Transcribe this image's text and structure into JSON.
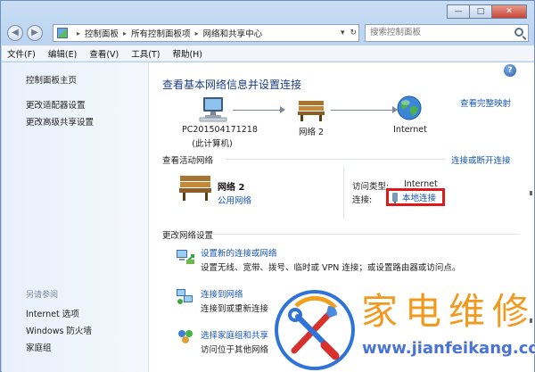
{
  "window": {
    "controls": {
      "minimize": "—",
      "maximize": "□",
      "close": "✕"
    },
    "address": {
      "breadcrumbs": [
        "控制面板",
        "所有控制面板项",
        "网络和共享中心"
      ],
      "separator": "▸",
      "dropdown": "▾",
      "refresh": "↻"
    },
    "search": {
      "placeholder": "搜索控制面板"
    },
    "nav": {
      "back": "◀",
      "forward": "▶"
    }
  },
  "menubar": {
    "items": [
      "文件(F)",
      "编辑(E)",
      "查看(V)",
      "工具(T)",
      "帮助(H)"
    ]
  },
  "sidebar": {
    "home": "控制面板主页",
    "links": [
      "更改适配器设置",
      "更改高级共享设置"
    ],
    "see_also_heading": "另请参阅",
    "see_also": [
      "Internet 选项",
      "Windows 防火墙",
      "家庭组"
    ]
  },
  "main": {
    "help": "?",
    "title": "查看基本网络信息并设置连接",
    "view_full_map": "查看完整映射",
    "map": {
      "computer_name": "PC201504171218",
      "computer_sub": "(此计算机)",
      "network_name": "网络  2",
      "internet": "Internet"
    },
    "active_heading": "查看活动网络",
    "connect_disconnect": "连接或断开连接",
    "active": {
      "name": "网络  2",
      "type": "公用网络",
      "access_type_label": "访问类型:",
      "access_type_value": "Internet",
      "connections_label": "连接:",
      "connection": "本地连接"
    },
    "change_heading": "更改网络设置",
    "tasks": [
      {
        "title": "设置新的连接或网络",
        "desc": "设置无线、宽带、拨号、临时或 VPN 连接；或设置路由器或访问点。"
      },
      {
        "title": "连接到网络",
        "desc": "连接到或重新连接"
      },
      {
        "title": "选择家庭组和共享",
        "desc": "访问位于其他网络"
      }
    ]
  },
  "watermark": {
    "brand": "家电维修",
    "url": "www.jianfeikang.com"
  }
}
